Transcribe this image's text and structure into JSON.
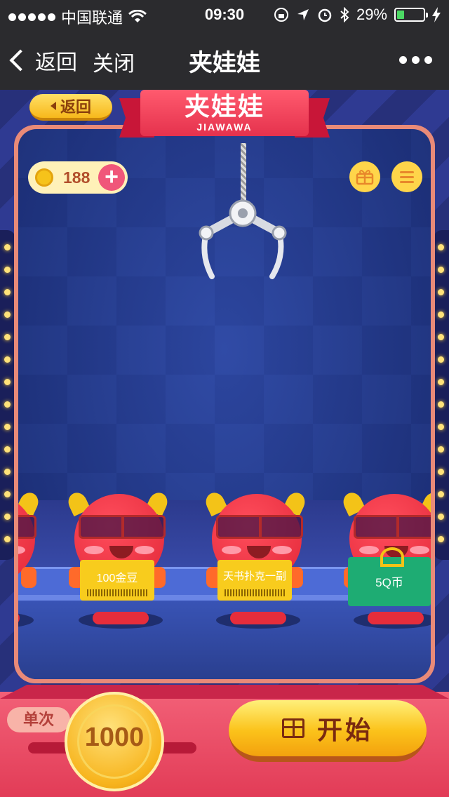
{
  "status_bar": {
    "carrier": "中国联通",
    "time": "09:30",
    "battery_percent": "29%",
    "battery_level": 0.29,
    "icons": [
      "signal-dots",
      "wifi-icon",
      "lock-rotation-icon",
      "location-icon",
      "alarm-icon",
      "bluetooth-icon",
      "battery-icon",
      "charging-icon"
    ]
  },
  "navbar": {
    "back_label": "返回",
    "close_label": "关闭",
    "title": "夹娃娃",
    "more_icon": "more-dots-icon"
  },
  "game": {
    "return_button": "返回",
    "banner_title": "夹娃娃",
    "banner_subtitle": "JIAWAWA",
    "coin_balance": "188",
    "plus_label": "+",
    "gift_icon": "gift-icon",
    "menu_icon": "menu-icon",
    "prizes": [
      {
        "label": "100金豆",
        "kind": "ticket"
      },
      {
        "label": "天书扑克一副",
        "kind": "ticket"
      },
      {
        "label": "5Q币",
        "kind": "gift-box"
      }
    ]
  },
  "bottom": {
    "single_label": "单次",
    "cost": "1000",
    "start_label": "开始"
  },
  "colors": {
    "nav_bg": "#2b2b2e",
    "cabinet_border": "#e98a78",
    "accent_yellow": "#fbc21a",
    "doll_red": "#e22838",
    "bottom_pink": "#f26077"
  }
}
